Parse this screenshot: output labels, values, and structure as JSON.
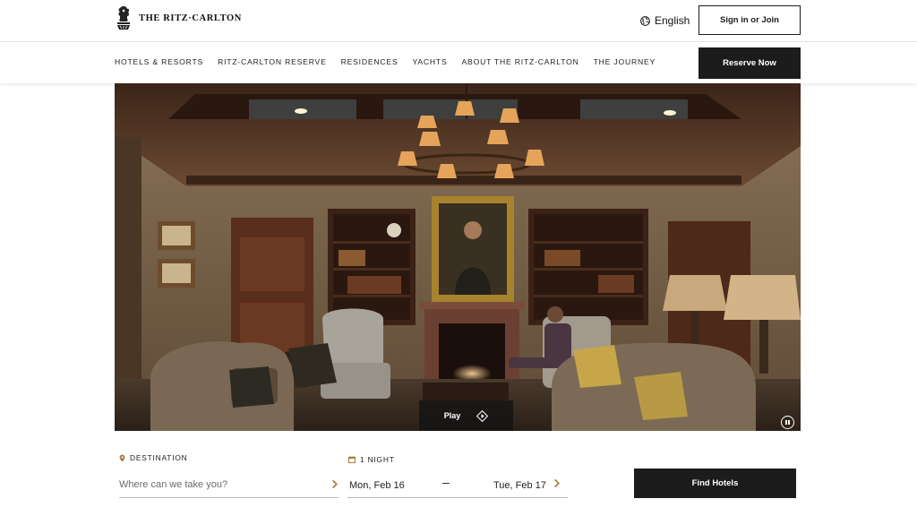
{
  "brand": {
    "name": "THE RITZ·CARLTON"
  },
  "header": {
    "language": {
      "label": "English",
      "icon": "globe-icon"
    },
    "signin_label": "Sign in or Join"
  },
  "nav": {
    "items": [
      {
        "label": "HOTELS & RESORTS"
      },
      {
        "label": "RITZ-CARLTON RESERVE"
      },
      {
        "label": "RESIDENCES"
      },
      {
        "label": "YACHTS"
      },
      {
        "label": "ABOUT THE RITZ-CARLTON"
      },
      {
        "label": "THE JOURNEY"
      }
    ],
    "reserve_label": "Reserve Now"
  },
  "hero": {
    "play_label": "Play",
    "play_icon": "diamond-play-icon",
    "pause_icon": "pause-icon"
  },
  "booking": {
    "destination_label": "DESTINATION",
    "destination_placeholder": "Where can we take you?",
    "nights_label": "1 NIGHT",
    "check_in": "Mon, Feb 16",
    "date_separator": "–",
    "check_out": "Tue, Feb 17",
    "find_label": "Find Hotels"
  },
  "colors": {
    "accent": "#a57c3e",
    "dark": "#1c1c1c"
  }
}
